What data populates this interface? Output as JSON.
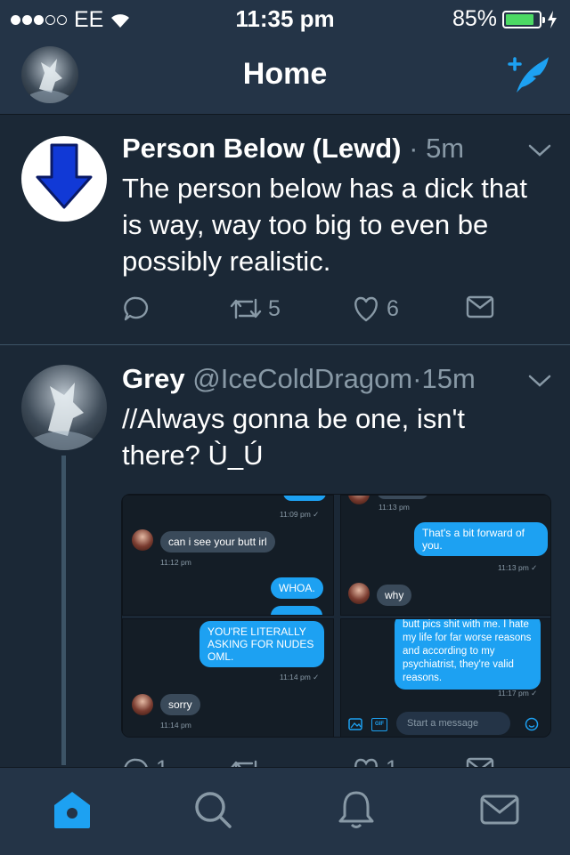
{
  "status": {
    "carrier": "EE",
    "time": "11:35 pm",
    "battery": "85%",
    "battery_level": 0.85
  },
  "header": {
    "title": "Home"
  },
  "tweets": [
    {
      "name": "Person Below (Lewd)",
      "handle": "",
      "separator": "·",
      "time": "5m",
      "text": "The person below has a dick that is way, way too big to even be possibly realistic.",
      "retweets": "5",
      "likes": "6"
    },
    {
      "name": "Grey",
      "handle": "@IceColdDragom",
      "separator": "·",
      "time": "15m",
      "text": "//Always gonna be one, isn't there? Ù_Ú",
      "replies": "1",
      "likes": "1"
    }
  ],
  "media": {
    "p1": {
      "ts1": "11:09 pm ✓",
      "msg1": "can i see your butt irl",
      "ts2": "11:12 pm",
      "msg2": "WHOA."
    },
    "p2": {
      "ts1": "11:13 pm",
      "msg1": "That's a bit forward of you.",
      "ts2": "11:13 pm ✓",
      "msg2": "why"
    },
    "p3": {
      "msg1": "YOU'RE LITERALLY ASKING FOR NUDES OML.",
      "ts1": "11:14 pm ✓",
      "msg2": "sorry",
      "ts2": "11:14 pm"
    },
    "p4": {
      "msg1": "butt pics  shit with me. I hate my life for far worse reasons and according to my psychiatrist, they're valid reasons.",
      "ts1": "11:17 pm ✓",
      "placeholder": "Start a message",
      "gif": "GIF"
    }
  },
  "colors": {
    "accent": "#1da1f2",
    "background": "#1b2836",
    "bar": "#243447",
    "muted": "#8899a6"
  }
}
